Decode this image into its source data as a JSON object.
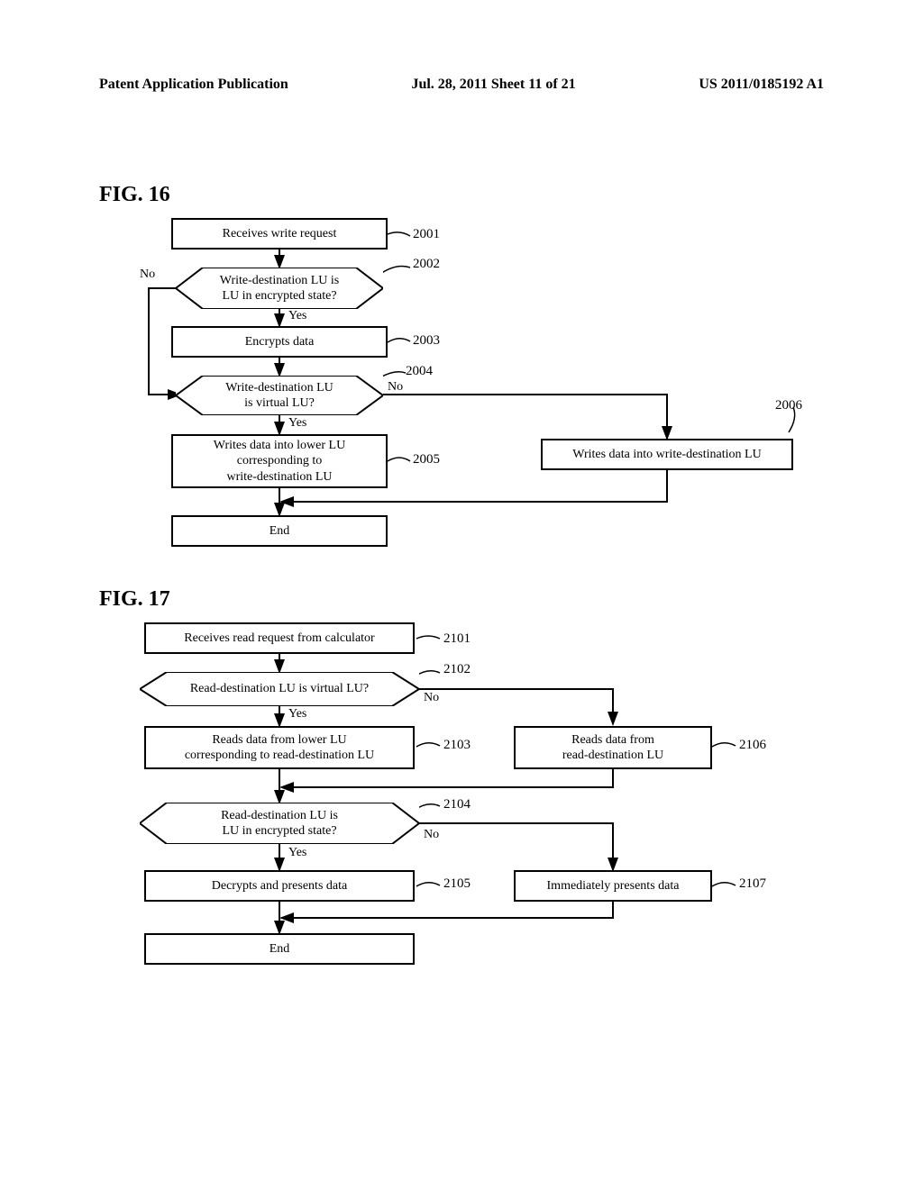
{
  "header": {
    "left": "Patent Application Publication",
    "middle": "Jul. 28, 2011   Sheet 11 of 21",
    "right": "US 2011/0185192 A1"
  },
  "fig16": {
    "label": "FIG. 16",
    "nodes": {
      "n2001": "Receives write request",
      "n2002": "Write-destination LU is\nLU in encrypted state?",
      "n2003": "Encrypts data",
      "n2004": "Write-destination LU\nis virtual LU?",
      "n2005": "Writes data into lower LU\ncorresponding to\nwrite-destination LU",
      "n2006": "Writes data into write-destination LU",
      "end": "End"
    },
    "refs": {
      "r2001": "2001",
      "r2002": "2002",
      "r2003": "2003",
      "r2004": "2004",
      "r2005": "2005",
      "r2006": "2006"
    },
    "labels": {
      "no": "No",
      "yes": "Yes"
    }
  },
  "fig17": {
    "label": "FIG. 17",
    "nodes": {
      "n2101": "Receives read request from calculator",
      "n2102": "Read-destination LU is virtual LU?",
      "n2103": "Reads data from lower LU\ncorresponding to read-destination LU",
      "n2104": "Read-destination LU is\nLU in encrypted state?",
      "n2105": "Decrypts and presents data",
      "n2106": "Reads data from\nread-destination LU",
      "n2107": "Immediately presents data",
      "end": "End"
    },
    "refs": {
      "r2101": "2101",
      "r2102": "2102",
      "r2103": "2103",
      "r2104": "2104",
      "r2105": "2105",
      "r2106": "2106",
      "r2107": "2107"
    },
    "labels": {
      "no": "No",
      "yes": "Yes"
    }
  }
}
